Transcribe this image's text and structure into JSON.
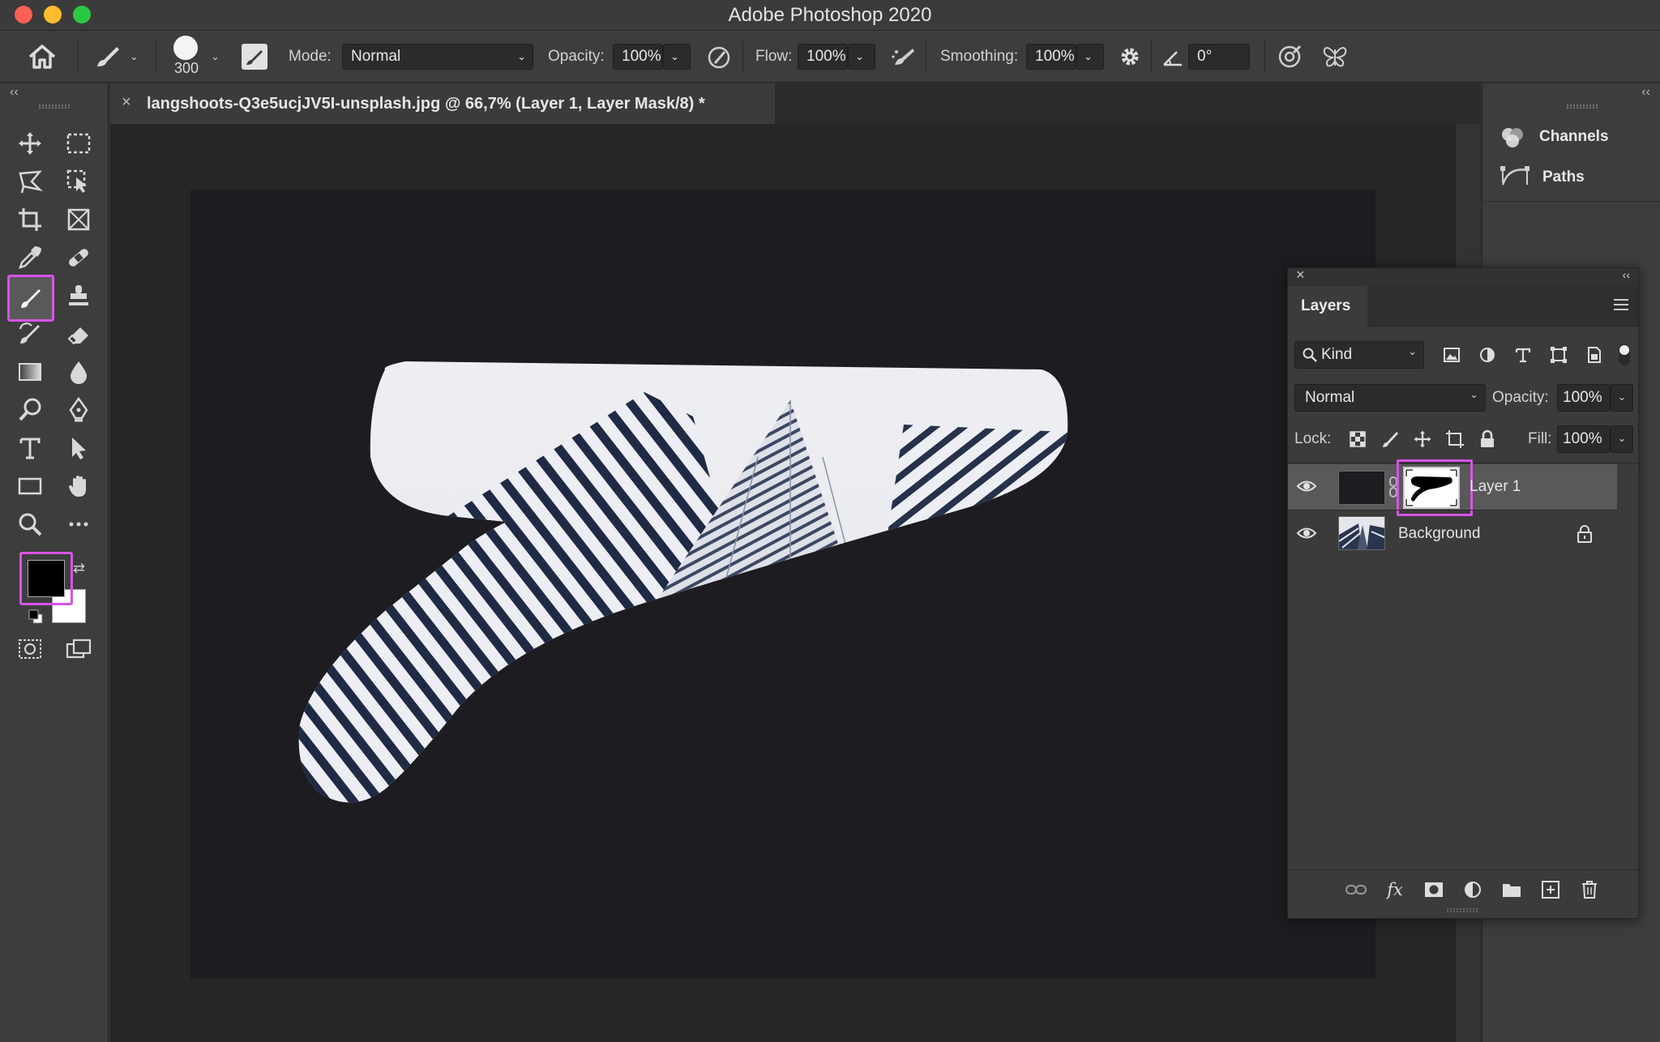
{
  "app": {
    "title": "Adobe Photoshop 2020"
  },
  "options_bar": {
    "brush_size": "300",
    "mode_label": "Mode:",
    "mode_value": "Normal",
    "opacity_label": "Opacity:",
    "opacity_value": "100%",
    "flow_label": "Flow:",
    "flow_value": "100%",
    "smoothing_label": "Smoothing:",
    "smoothing_value": "100%",
    "angle_value": "0°"
  },
  "document": {
    "tab_title": "langshoots-Q3e5ucjJV5I-unsplash.jpg @ 66,7% (Layer 1, Layer Mask/8) *"
  },
  "right_dock": {
    "items": [
      {
        "label": "Channels",
        "icon": "channels-icon"
      },
      {
        "label": "Paths",
        "icon": "paths-icon"
      }
    ]
  },
  "layers_panel": {
    "tab_label": "Layers",
    "filter_kind": "Kind",
    "blend_mode": "Normal",
    "opacity_label": "Opacity:",
    "opacity_value": "100%",
    "lock_label": "Lock:",
    "fill_label": "Fill:",
    "fill_value": "100%",
    "layers": [
      {
        "name": "Layer 1",
        "selected": true,
        "has_mask": true
      },
      {
        "name": "Background",
        "selected": false,
        "locked": true
      }
    ]
  },
  "colors": {
    "highlight": "#d654e6",
    "foreground": "#000000",
    "background": "#ffffff"
  }
}
